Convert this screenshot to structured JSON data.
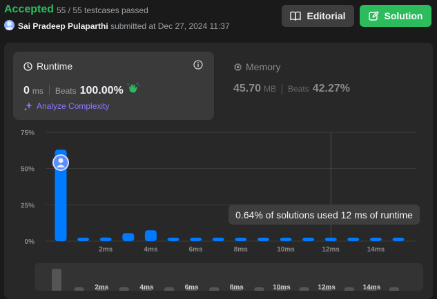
{
  "header": {
    "status": "Accepted",
    "testcases": "55 / 55 testcases passed",
    "user": "Sai Pradeep Pulaparthi",
    "submitted": "submitted at Dec 27, 2024 11:37",
    "editorial_label": "Editorial",
    "solution_label": "Solution"
  },
  "runtime": {
    "title": "Runtime",
    "value": "0",
    "unit": "ms",
    "beats_label": "Beats",
    "beats": "100.00%",
    "analyze_label": "Analyze Complexity"
  },
  "memory": {
    "title": "Memory",
    "value": "45.70",
    "unit": "MB",
    "beats_label": "Beats",
    "beats": "42.27%"
  },
  "tooltip": "0.64% of solutions used 12 ms of runtime",
  "colors": {
    "accepted": "#2cbb5d",
    "bar": "#007aff",
    "analyze": "#8e77ff"
  },
  "chart_data": {
    "type": "bar",
    "y_tick_labels": [
      "75%",
      "50%",
      "25%",
      "0%"
    ],
    "ylim": [
      0,
      75
    ],
    "x_tick_labels": [
      "2ms",
      "4ms",
      "6ms",
      "8ms",
      "10ms",
      "12ms",
      "14ms"
    ],
    "x_ms": [
      0,
      1,
      2,
      3,
      4,
      5,
      6,
      7,
      8,
      9,
      10,
      11,
      12,
      13,
      14,
      15
    ],
    "values": [
      63,
      1.5,
      2.5,
      5.5,
      7.5,
      1.5,
      1.5,
      1.5,
      1.5,
      1.5,
      1.5,
      1.5,
      0.64,
      1.5,
      1.5,
      1.5
    ],
    "highlight_index": 0,
    "hover_index": 12,
    "grid": true
  }
}
